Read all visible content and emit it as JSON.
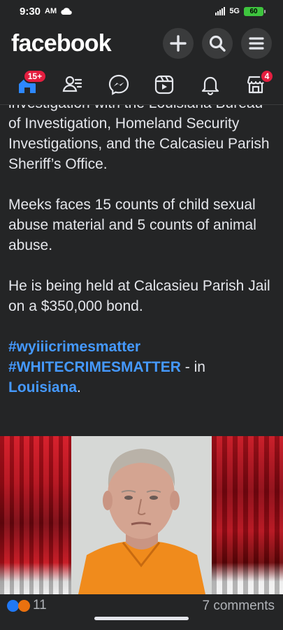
{
  "status_bar": {
    "time": "9:30",
    "ampm": "AM",
    "network": "5G",
    "battery": "60"
  },
  "header": {
    "logo": "facebook",
    "actions": [
      "plus-icon",
      "search-icon",
      "menu-icon"
    ]
  },
  "nav": {
    "items": [
      {
        "name": "home",
        "icon": "home-icon",
        "badge": "15+"
      },
      {
        "name": "friends",
        "icon": "friends-icon",
        "badge": ""
      },
      {
        "name": "messenger",
        "icon": "messenger-icon",
        "badge": ""
      },
      {
        "name": "reels",
        "icon": "reels-icon",
        "badge": ""
      },
      {
        "name": "notifications",
        "icon": "bell-icon",
        "badge": ""
      },
      {
        "name": "marketplace",
        "icon": "marketplace-icon",
        "badge": "4"
      }
    ],
    "accent": "#2d88ff"
  },
  "post": {
    "para1": "investigation with the Louisiana Bureau of Investigation, Homeland Security Investigations, and the Calcasieu Parish Sheriff’s Office.",
    "para2": "Meeks faces 15 counts of child sexual abuse material and 5 counts of animal abuse.",
    "para3": "He is being held at Calcasieu Parish Jail on a $350,000 bond.",
    "hashtag1": "#wyiiicrimesmatter",
    "hashtag2": "#WHITECRIMESMATTER",
    "in_text": " - in ",
    "location": "Louisiana",
    "period": ".",
    "link_color": "#4599ff"
  },
  "photo": {
    "description_icon": "mugshot-photo"
  },
  "reactions": {
    "count": "11",
    "comments": "7 comments"
  },
  "colors": {
    "background": "#242526",
    "badge": "#e41e3f",
    "text": "#e4e6eb"
  }
}
